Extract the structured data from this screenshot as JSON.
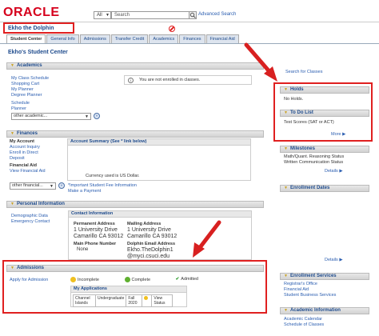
{
  "header": {
    "logo": "ORACLE",
    "search_scope": "All",
    "search_placeholder": "Search",
    "advanced_search": "Advanced Search"
  },
  "student_name": "Ekho the Dolphin",
  "tabs": [
    "Student Center",
    "General Info",
    "Admissions",
    "Transfer Credit",
    "Academics",
    "Finances",
    "Financial Aid"
  ],
  "page_title": "Ekho's Student Center",
  "academics": {
    "title": "Academics",
    "links": [
      "My Class Schedule",
      "Shopping Cart",
      "My Planner",
      "Degree Planner"
    ],
    "links2": [
      "Schedule",
      "Planner"
    ],
    "message": "You are not enrolled in classes.",
    "dropdown": "other academic..."
  },
  "finances": {
    "title": "Finances",
    "my_account_label": "My Account",
    "account_links": [
      "Account Inquiry",
      "Enroll in Direct",
      "Deposit"
    ],
    "financial_aid_label": "Financial Aid",
    "aid_links": [
      "View Financial Aid"
    ],
    "summary_title": "Account Summary (See * link below)",
    "currency_note": "Currency used is US Dollar.",
    "important_info": "*Important Student Fee Information",
    "make_payment": "Make a Payment",
    "dropdown": "other financial..."
  },
  "personal": {
    "title": "Personal Information",
    "links": [
      "Demographic Data",
      "Emergency Contact"
    ],
    "contact_title": "Contact Information",
    "permanent_label": "Permanent Address",
    "permanent_value": [
      "1 University Drive",
      "Camarillo CA 93012"
    ],
    "mailing_label": "Mailing Address",
    "mailing_value": [
      "1 University Drive",
      "Camarillo CA 93012"
    ],
    "phone_label": "Main Phone Number",
    "phone_value": "None",
    "email_label": "Dolphin Email Address",
    "email_value": [
      "Ekho.TheDolphin1",
      "@myci.csuci.edu"
    ]
  },
  "admissions": {
    "title": "Admissions",
    "apply_link": "Apply for Admission",
    "legend": [
      "Incomplete",
      "Complete",
      "Admitted"
    ],
    "apps_title": "My Applications",
    "row": [
      "Channel Islands",
      "Undergraduate",
      "Fall 2020",
      "View Status"
    ]
  },
  "right": {
    "search_classes": "Search for Classes",
    "holds_title": "Holds",
    "holds_text": "No Holds.",
    "todo_title": "To Do List",
    "todo_text": "Test Scores (SAT or ACT)",
    "more": "More",
    "milestones_title": "Milestones",
    "milestones_items": [
      "Math/Quant. Reasoning Status",
      "Written Communication Status"
    ],
    "details": "Details",
    "enrollment_dates_title": "Enrollment Dates",
    "enrollment_services_title": "Enrollment Services",
    "enrollment_services_links": [
      "Registrar's Office",
      "Financial Aid",
      "Student Business Services"
    ],
    "academic_info_title": "Academic Information",
    "academic_info_links": [
      "Academic Calendar",
      "Schedule of Classes"
    ]
  },
  "colors": {
    "annotation_red": "#e02020",
    "link_blue": "#2a5db0",
    "incomplete": "#f0c020",
    "complete": "#60b030",
    "admitted": "#2a9a2a"
  }
}
